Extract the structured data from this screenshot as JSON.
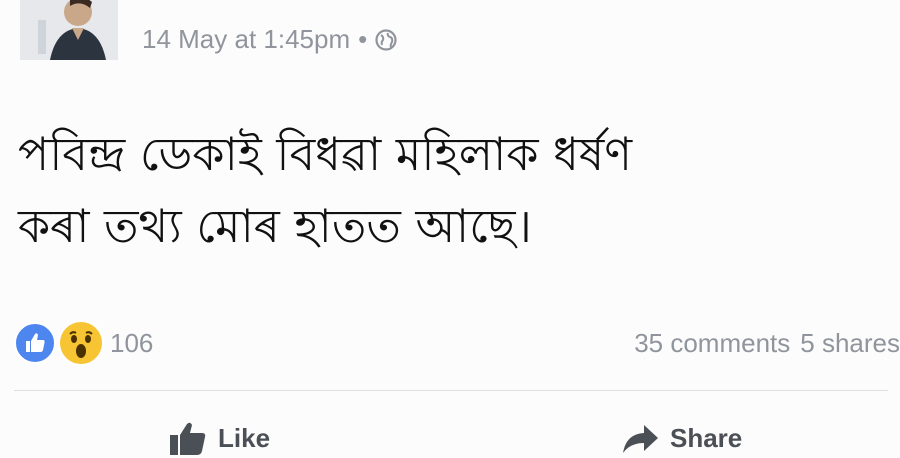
{
  "post": {
    "timestamp": "14 May at 1:45pm",
    "separator": "•",
    "privacy_icon": "globe-icon",
    "text_lines": [
      "পবিন্দ্ৰ ডেকাই বিধৱা মহিলাক ধৰ্ষণ",
      "কৰা তথ্য মোৰ হাতত আছে।"
    ]
  },
  "reactions": {
    "icons": [
      "like-reaction-icon",
      "wow-reaction-icon"
    ],
    "count": "106"
  },
  "stats": {
    "comments": "35 comments",
    "shares": "5 shares"
  },
  "actions": {
    "like_label": "Like",
    "share_label": "Share"
  },
  "colors": {
    "like_blue": "#4e86f0",
    "wow_yellow": "#f7c533",
    "muted_text": "#90949c",
    "action_text": "#4b4f56"
  }
}
